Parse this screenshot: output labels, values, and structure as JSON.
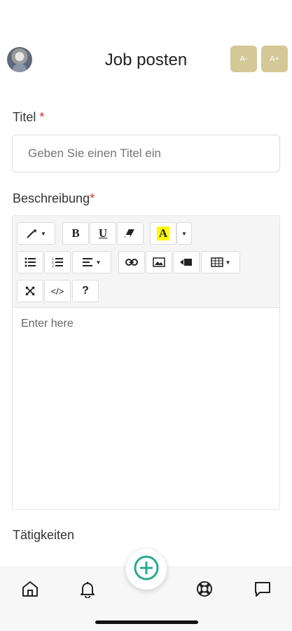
{
  "header": {
    "title": "Job posten",
    "font_decrease": "A-",
    "font_increase": "A+"
  },
  "form": {
    "title_label": "Titel",
    "required_mark": "*",
    "title_placeholder": "Geben Sie einen Titel ein",
    "description_label": "Beschreibung",
    "editor_placeholder": "Enter here",
    "activities_label": "Tätigkeiten"
  },
  "toolbar": {
    "bold": "B",
    "underline": "U",
    "highlight": "A",
    "code": "</>",
    "help": "?"
  },
  "colors": {
    "accent_button": "#d4c896",
    "required": "#d32f2f",
    "fab_green": "#2aa98f",
    "highlight_yellow": "#ffff00"
  },
  "nav": {
    "icons": [
      "home-icon",
      "bell-icon",
      "add-circle-icon",
      "lifebuoy-icon",
      "chat-icon"
    ]
  }
}
